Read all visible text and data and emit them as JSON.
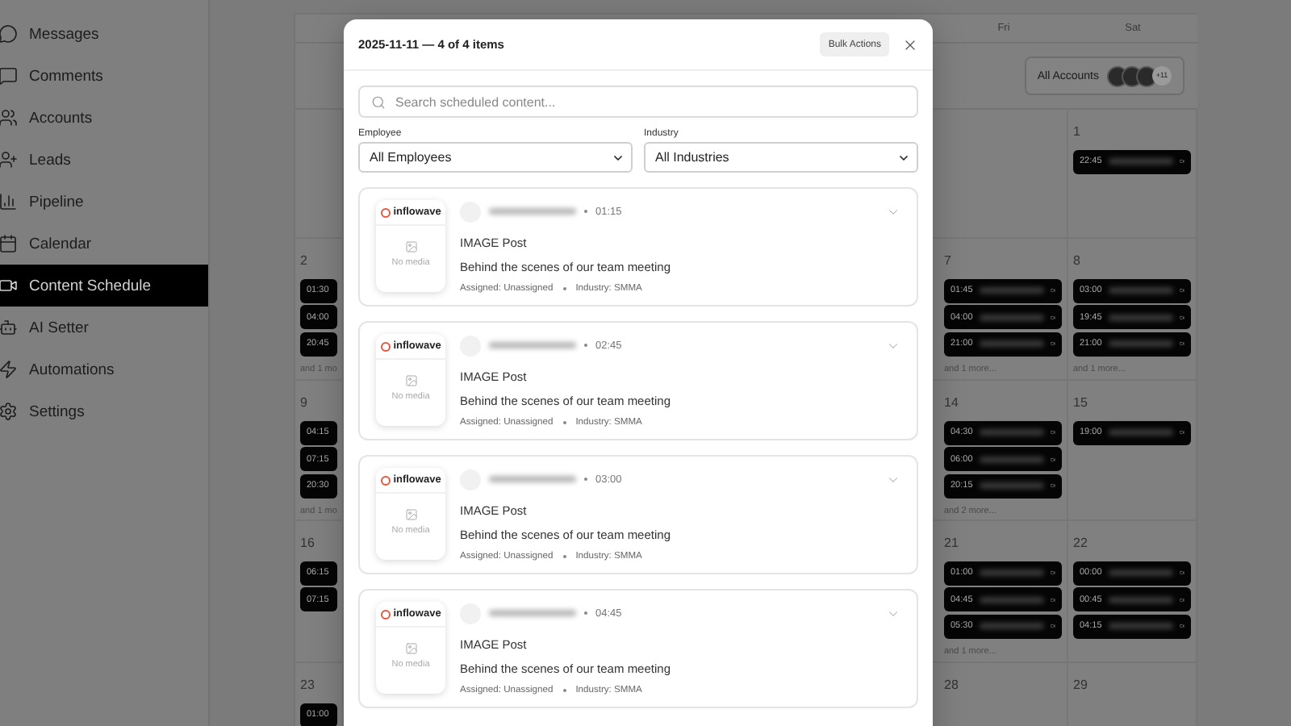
{
  "sidebar": {
    "items": [
      {
        "label": "Messages",
        "selected": false
      },
      {
        "label": "Comments",
        "selected": false
      },
      {
        "label": "Accounts",
        "selected": false
      },
      {
        "label": "Leads",
        "selected": false
      },
      {
        "label": "Pipeline",
        "selected": false
      },
      {
        "label": "Calendar",
        "selected": false
      },
      {
        "label": "Content Schedule",
        "selected": true
      },
      {
        "label": "AI Setter",
        "selected": false
      },
      {
        "label": "Automations",
        "selected": false
      },
      {
        "label": "Settings",
        "selected": false
      }
    ]
  },
  "calendar": {
    "day_headers": [
      "Fri",
      "Sat"
    ],
    "account_filter": {
      "label": "All Accounts",
      "more_count": "+11"
    },
    "weeks": [
      {
        "sat": {
          "number": "1",
          "events": [
            {
              "time": "22:45"
            }
          ]
        }
      },
      {
        "sun": {
          "number": "2",
          "events": [
            {
              "time": "01:30"
            },
            {
              "time": "04:00"
            },
            {
              "time": "20:45"
            }
          ],
          "more": "and 1 mo"
        },
        "fri": {
          "number": "7",
          "events": [
            {
              "time": "01:45"
            },
            {
              "time": "04:00"
            },
            {
              "time": "21:00"
            }
          ],
          "more": "and 1 more..."
        },
        "sat": {
          "number": "8",
          "events": [
            {
              "time": "03:00"
            },
            {
              "time": "19:45"
            },
            {
              "time": "21:00"
            }
          ],
          "more": "and 1 more..."
        }
      },
      {
        "sun": {
          "number": "9",
          "events": [
            {
              "time": "04:15"
            },
            {
              "time": "07:15"
            },
            {
              "time": "20:30"
            }
          ],
          "more": "and 1 mo"
        },
        "fri": {
          "number": "14",
          "events": [
            {
              "time": "04:30"
            },
            {
              "time": "06:00"
            },
            {
              "time": "20:15"
            }
          ],
          "more": "and 2 more..."
        },
        "sat": {
          "number": "15",
          "events": [
            {
              "time": "19:00"
            }
          ]
        }
      },
      {
        "sun": {
          "number": "16",
          "events": [
            {
              "time": "06:15"
            },
            {
              "time": "07:15"
            }
          ]
        },
        "fri": {
          "number": "21",
          "events": [
            {
              "time": "01:00"
            },
            {
              "time": "04:45"
            },
            {
              "time": "05:30"
            }
          ],
          "more": "and 1 more..."
        },
        "sat": {
          "number": "22",
          "events": [
            {
              "time": "00:00"
            },
            {
              "time": "00:45"
            },
            {
              "time": "04:15"
            }
          ]
        }
      },
      {
        "sun": {
          "number": "23",
          "events": [
            {
              "time": "01:00"
            }
          ]
        },
        "fri": {
          "number": "28"
        },
        "sat": {
          "number": "29"
        }
      }
    ]
  },
  "modal": {
    "title": "2025-11-11 — 4 of 4 items",
    "bulk_button": "Bulk Actions",
    "search": {
      "placeholder": "Search scheduled content..."
    },
    "filters": [
      {
        "label": "Employee",
        "value": "All Employees"
      },
      {
        "label": "Industry",
        "value": "All Industries"
      }
    ],
    "items": [
      {
        "brand": "inflowave",
        "media": "No media",
        "time": "01:15",
        "type": "IMAGE Post",
        "caption": "Behind the scenes of our team meeting",
        "assigned": "Assigned: Unassigned",
        "industry": "Industry: SMMA"
      },
      {
        "brand": "inflowave",
        "media": "No media",
        "time": "02:45",
        "type": "IMAGE Post",
        "caption": "Behind the scenes of our team meeting",
        "assigned": "Assigned: Unassigned",
        "industry": "Industry: SMMA"
      },
      {
        "brand": "inflowave",
        "media": "No media",
        "time": "03:00",
        "type": "IMAGE Post",
        "caption": "Behind the scenes of our team meeting",
        "assigned": "Assigned: Unassigned",
        "industry": "Industry: SMMA"
      },
      {
        "brand": "inflowave",
        "media": "No media",
        "time": "04:45",
        "type": "IMAGE Post",
        "caption": "Behind the scenes of our team meeting",
        "assigned": "Assigned: Unassigned",
        "industry": "Industry: SMMA"
      }
    ]
  }
}
